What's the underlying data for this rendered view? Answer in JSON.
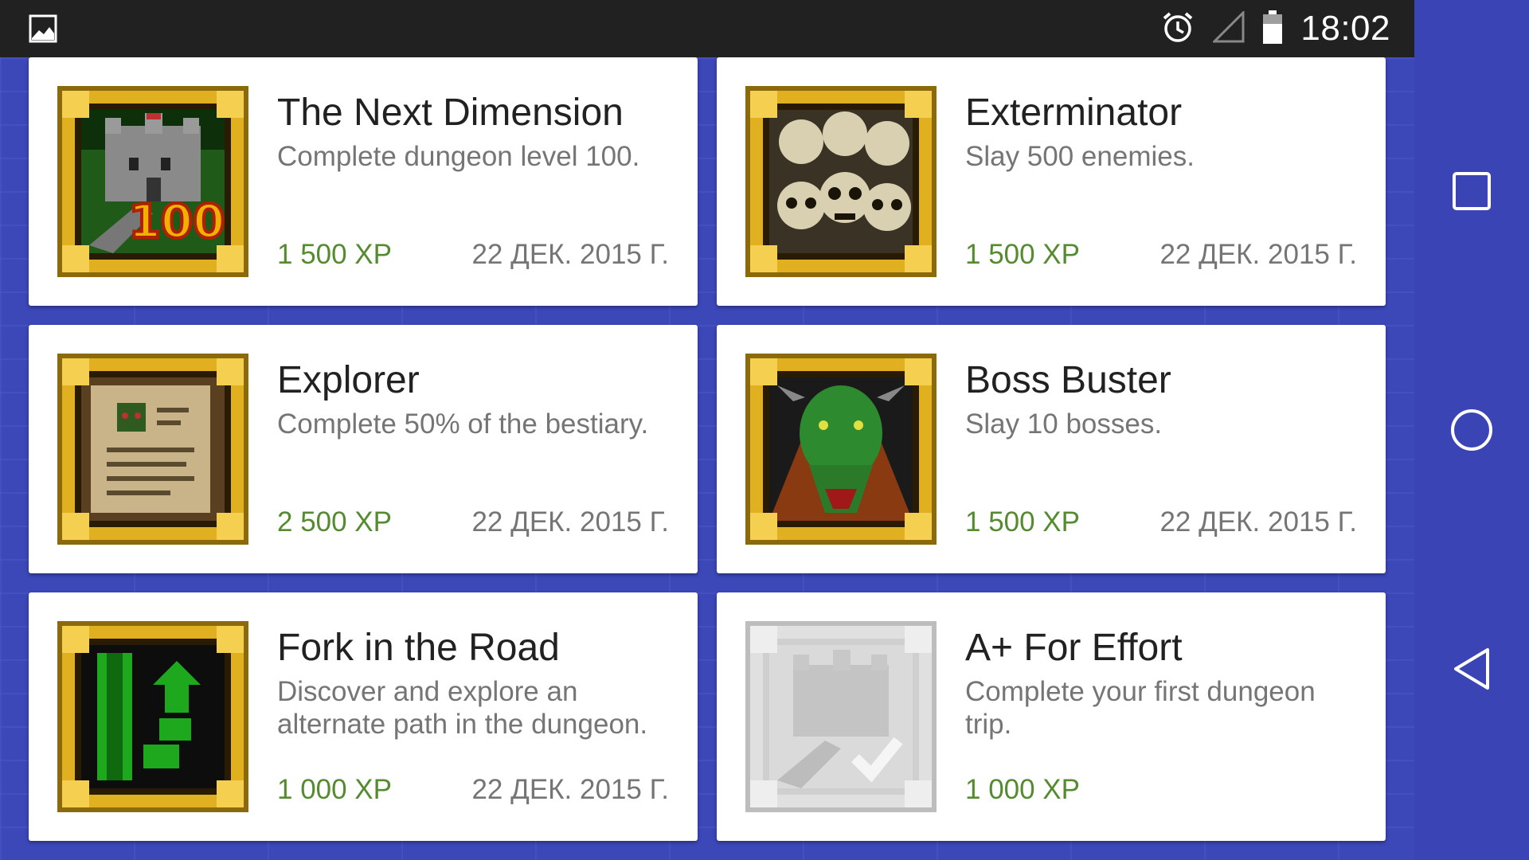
{
  "status_bar": {
    "time": "18:02",
    "left_icon": "image-notification-icon",
    "icons": [
      "alarm-icon",
      "signal-icon",
      "battery-icon"
    ]
  },
  "nav_bar": {
    "buttons": [
      "recents-button",
      "home-button",
      "back-button"
    ]
  },
  "colors": {
    "xp_green": "#558b2f",
    "background_blue": "#3c47b8",
    "frame_gold": "#d4a017"
  },
  "achievements": [
    {
      "title": "The Next Dimension",
      "description": "Complete dungeon level 100.",
      "xp": "1 500 XP",
      "date": "22 ДЕК. 2015 Г.",
      "icon": "castle-100-icon",
      "locked": false
    },
    {
      "title": "Exterminator",
      "description": "Slay 500 enemies.",
      "xp": "1 500 XP",
      "date": "22 ДЕК. 2015 Г.",
      "icon": "skulls-icon",
      "locked": false
    },
    {
      "title": "Explorer",
      "description": "Complete 50% of the bestiary.",
      "xp": "2 500 XP",
      "date": "22 ДЕК. 2015 Г.",
      "icon": "bestiary-book-icon",
      "locked": false
    },
    {
      "title": "Boss Buster",
      "description": "Slay 10 bosses.",
      "xp": "1 500 XP",
      "date": "22 ДЕК. 2015 Г.",
      "icon": "dragon-boss-icon",
      "locked": false
    },
    {
      "title": "Fork in the Road",
      "description": "Discover and explore an alternate path in the dungeon.",
      "xp": "1 000 XP",
      "date": "22 ДЕК. 2015 Г.",
      "icon": "fork-path-icon",
      "locked": false
    },
    {
      "title": "A+ For Effort",
      "description": "Complete your first dungeon trip.",
      "xp": "1 000 XP",
      "date": "",
      "icon": "castle-check-icon",
      "locked": true
    }
  ]
}
